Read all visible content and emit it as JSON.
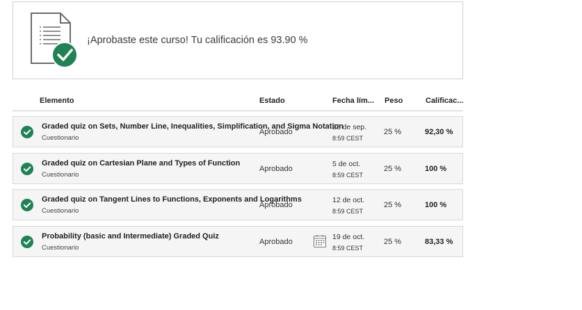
{
  "banner": {
    "message": "¡Aprobaste este curso! Tu calificación es 93.90 %",
    "icon": "document-check-icon"
  },
  "columns": {
    "element": "Elemento",
    "status": "Estado",
    "due": "Fecha lím...",
    "weight": "Peso",
    "grade": "Calificac..."
  },
  "rows": [
    {
      "title": "Graded quiz on Sets, Number Line, Inequalities, Simplification, and Sigma Notation",
      "type": "Cuestionario",
      "status": "Aprobado",
      "date": "28 de sep.",
      "time": "8:59 CEST",
      "weight": "25 %",
      "grade": "92,30 %"
    },
    {
      "title": "Graded quiz on Cartesian Plane and Types of Function",
      "type": "Cuestionario",
      "status": "Aprobado",
      "date": "5 de oct.",
      "time": "8:59 CEST",
      "weight": "25 %",
      "grade": "100 %"
    },
    {
      "title": "Graded quiz on Tangent Lines to Functions, Exponents and Logarithms",
      "type": "Cuestionario",
      "status": "Aprobado",
      "date": "12 de oct.",
      "time": "8:59 CEST",
      "weight": "25 %",
      "grade": "100 %"
    },
    {
      "title": "Probability (basic and Intermediate) Graded Quiz",
      "type": "Cuestionario",
      "status": "Aprobado",
      "date": "19 de oct.",
      "time": "8:59 CEST",
      "weight": "25 %",
      "grade": "83,33 %"
    }
  ],
  "colors": {
    "success_green": "#1f8354",
    "border": "#d9d9d9",
    "row_bg": "#f5f5f5"
  }
}
